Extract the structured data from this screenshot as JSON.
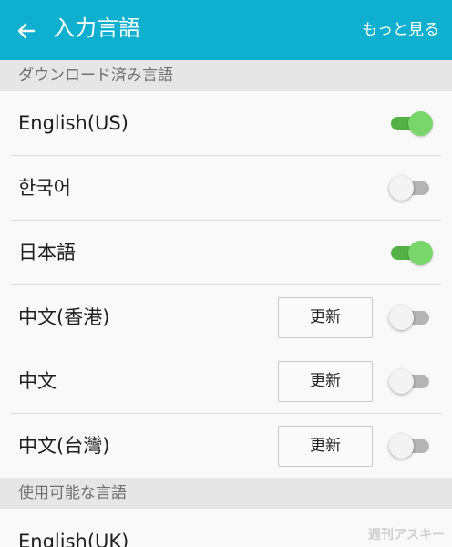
{
  "header": {
    "title": "入力言語",
    "more_label": "もっと見る",
    "background": "#0fb0cf"
  },
  "sections": {
    "downloaded_title": "ダウンロード済み言語",
    "available_title": "使用可能な言語"
  },
  "downloaded": [
    {
      "label": "English(US)",
      "enabled": true
    },
    {
      "label": "한국어",
      "enabled": false
    },
    {
      "label": "日本語",
      "enabled": true
    },
    {
      "label": "中文(香港)",
      "enabled": false,
      "update_label": "更新"
    },
    {
      "label": "中文",
      "enabled": false,
      "update_label": "更新"
    },
    {
      "label": "中文(台灣)",
      "enabled": false,
      "update_label": "更新"
    }
  ],
  "available": [
    {
      "label": "English(UK)"
    }
  ],
  "watermark": "週刊アスキー",
  "colors": {
    "toggle_on": "#54b146",
    "toggle_off": "#b4b4b4"
  }
}
